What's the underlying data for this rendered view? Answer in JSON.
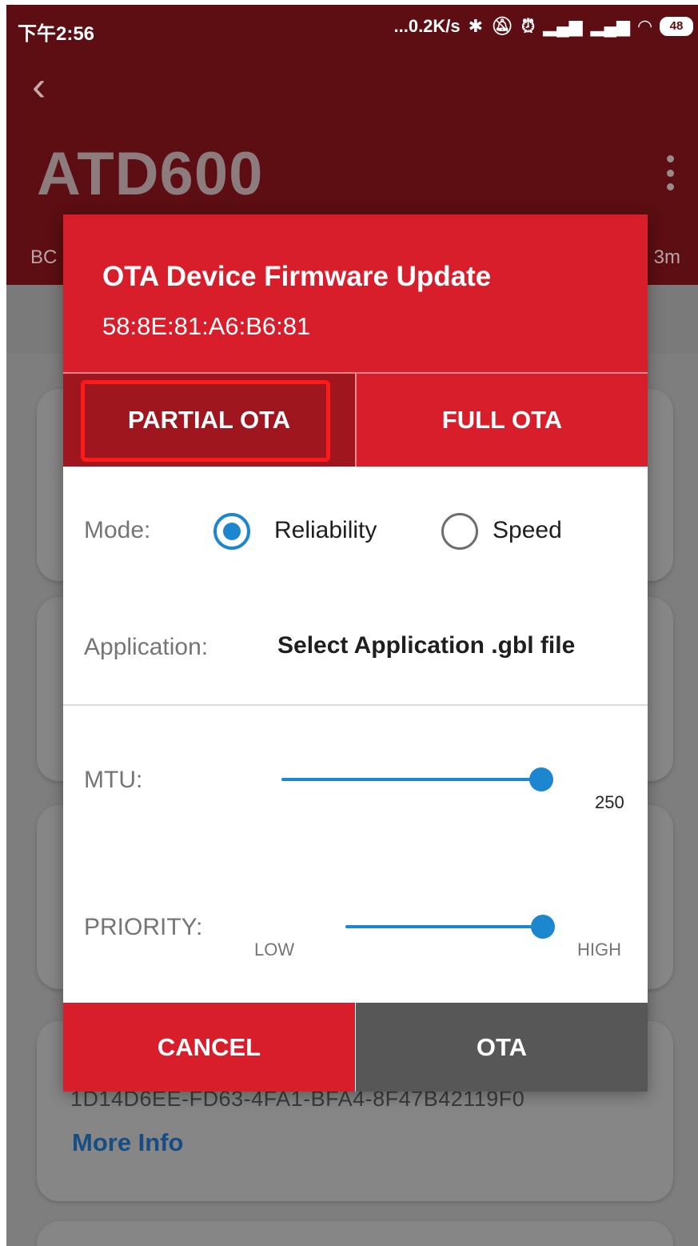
{
  "status_bar": {
    "time": "下午2:56",
    "net_speed": "...0.2K/s",
    "battery": "48",
    "icons": [
      "bluetooth-icon",
      "mute-icon",
      "alarm-icon",
      "signal-icon",
      "hd-signal-icon",
      "wifi-icon",
      "battery-icon"
    ]
  },
  "app_bar": {
    "title": "ATD600",
    "partial_left": "BC",
    "partial_right": "3m"
  },
  "background_card": {
    "uuid": "1D14D6EE-FD63-4FA1-BFA4-8F47B42119F0",
    "more_info": "More Info"
  },
  "dialog": {
    "title": "OTA Device Firmware Update",
    "address": "58:8E:81:A6:B6:81",
    "tabs": [
      {
        "label": "PARTIAL OTA",
        "selected": true
      },
      {
        "label": "FULL OTA",
        "selected": false
      }
    ],
    "mode": {
      "label": "Mode:",
      "options": [
        {
          "label": "Reliability",
          "selected": true
        },
        {
          "label": "Speed",
          "selected": false
        }
      ]
    },
    "application": {
      "label": "Application:",
      "value": "Select Application .gbl file"
    },
    "mtu": {
      "label": "MTU:",
      "value": "250",
      "level": 1.0
    },
    "priority": {
      "label": "PRIORITY:",
      "low_label": "LOW",
      "high_label": "HIGH",
      "level": 1.0
    },
    "buttons": {
      "cancel": "CANCEL",
      "ota": "OTA"
    }
  },
  "colors": {
    "app_bar": "#5c0e12",
    "dialog_red": "#d81e2a",
    "selected_tab": "#a0161f",
    "accent_blue": "#1c86cf",
    "ota_button": "#575757",
    "highlight_box": "#ff1a1a"
  }
}
